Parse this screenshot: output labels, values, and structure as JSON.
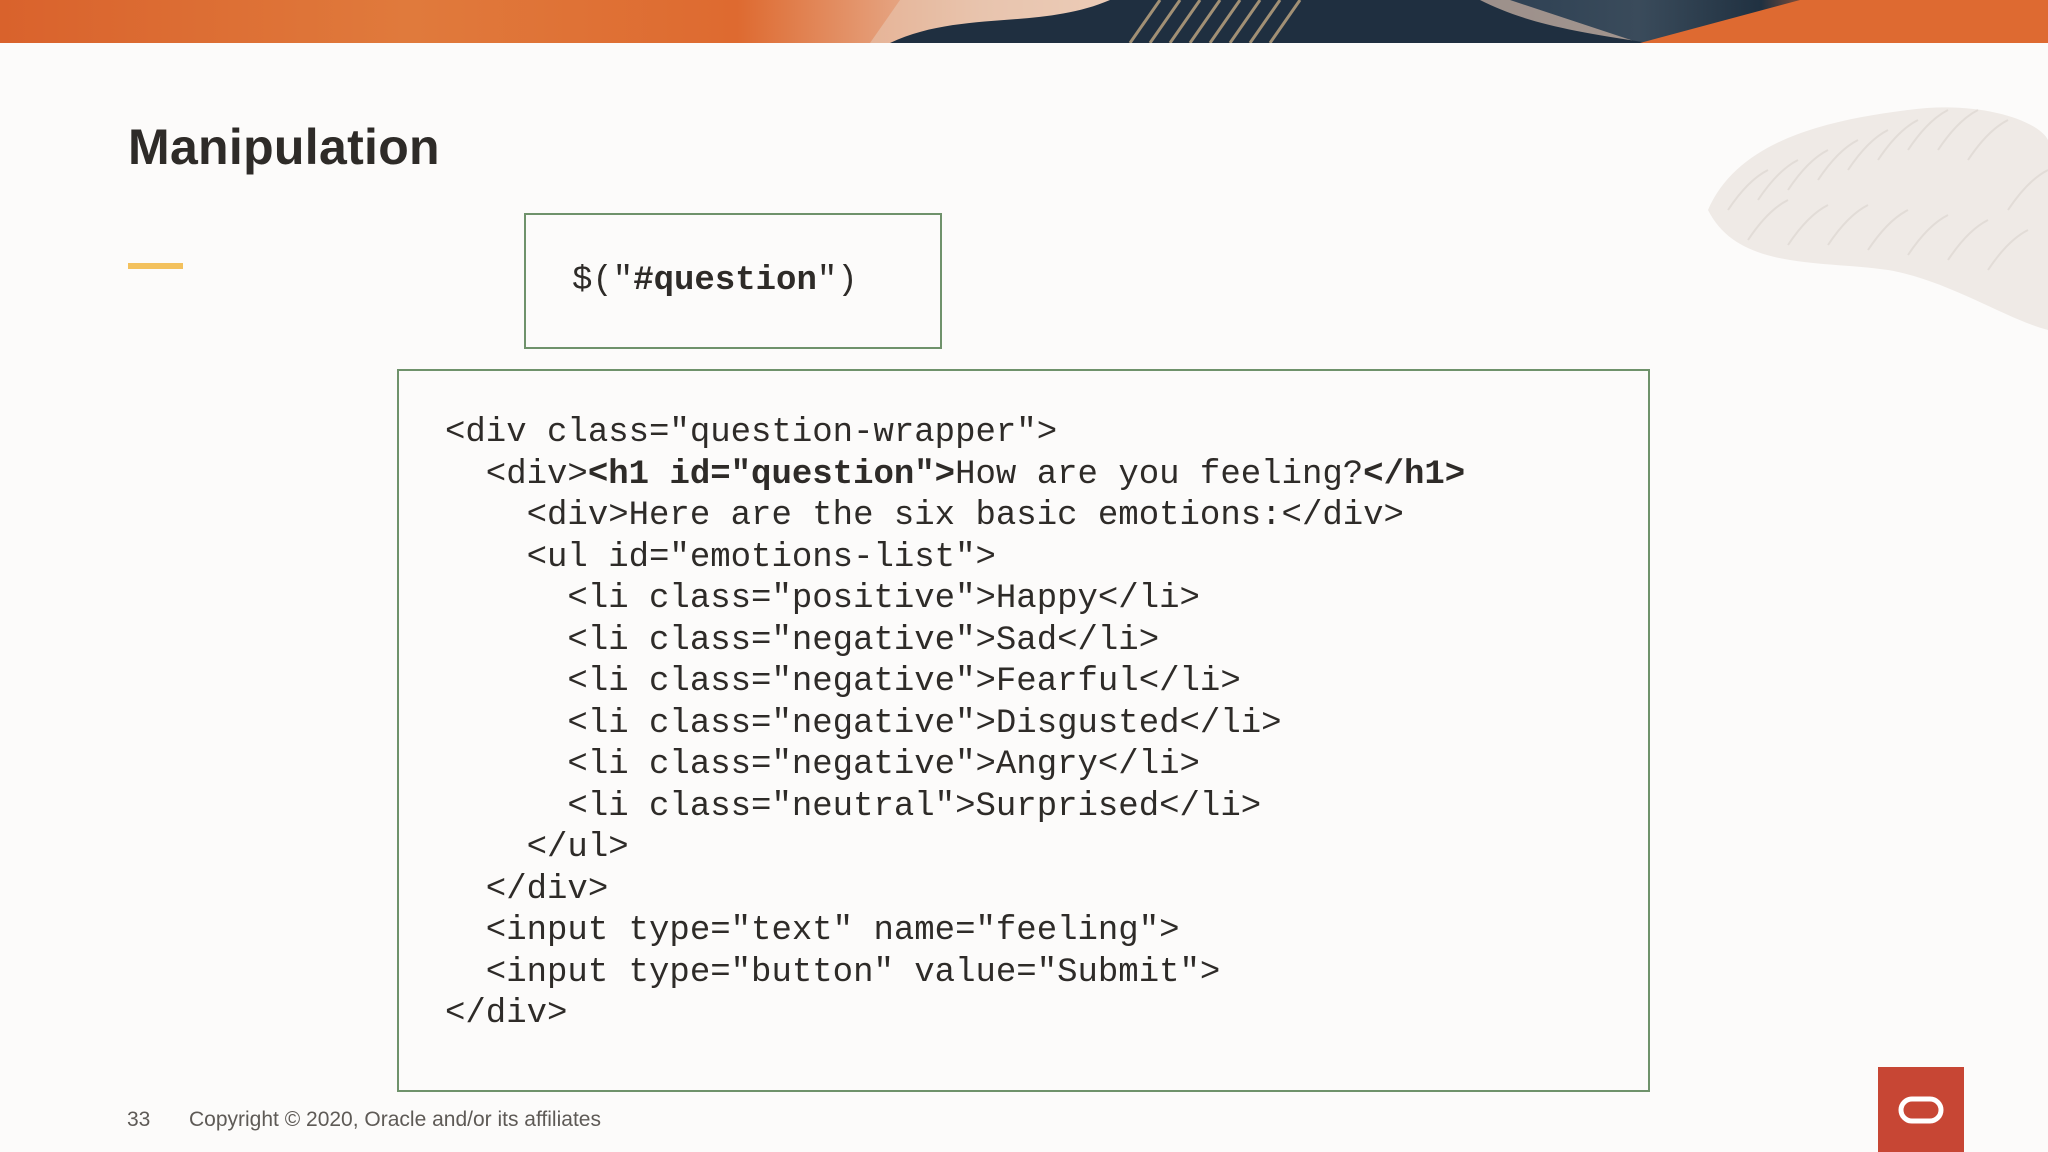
{
  "slide": {
    "title": "Manipulation",
    "page_number": "33",
    "copyright": "Copyright © 2020, Oracle and/or its affiliates"
  },
  "selector": {
    "prefix": "$(\"",
    "id": "#question",
    "suffix": "\")"
  },
  "code_lines": [
    {
      "parts": [
        {
          "t": "<div class=\"question-wrapper\">"
        }
      ]
    },
    {
      "parts": [
        {
          "t": "  <div>"
        },
        {
          "t": "<h1 id=\"question\">",
          "b": true
        },
        {
          "t": "How are you feeling?"
        },
        {
          "t": "</h1>",
          "b": true
        }
      ]
    },
    {
      "parts": [
        {
          "t": "    <div>Here are the six basic emotions:</div>"
        }
      ]
    },
    {
      "parts": [
        {
          "t": "    <ul id=\"emotions-list\">"
        }
      ]
    },
    {
      "parts": [
        {
          "t": "      <li class=\"positive\">Happy</li>"
        }
      ]
    },
    {
      "parts": [
        {
          "t": "      <li class=\"negative\">Sad</li>"
        }
      ]
    },
    {
      "parts": [
        {
          "t": "      <li class=\"negative\">Fearful</li>"
        }
      ]
    },
    {
      "parts": [
        {
          "t": "      <li class=\"negative\">Disgusted</li>"
        }
      ]
    },
    {
      "parts": [
        {
          "t": "      <li class=\"negative\">Angry</li>"
        }
      ]
    },
    {
      "parts": [
        {
          "t": "      <li class=\"neutral\">Surprised</li>"
        }
      ]
    },
    {
      "parts": [
        {
          "t": "    </ul>"
        }
      ]
    },
    {
      "parts": [
        {
          "t": "  </div>"
        }
      ]
    },
    {
      "parts": [
        {
          "t": "  <input type=\"text\" name=\"feeling\">"
        }
      ]
    },
    {
      "parts": [
        {
          "t": "  <input type=\"button\" value=\"Submit\">"
        }
      ]
    },
    {
      "parts": [
        {
          "t": "</div>"
        }
      ]
    }
  ],
  "icons": {
    "logo": "oracle-logo-icon"
  },
  "colors": {
    "logo_red": "#c74634",
    "accent_yellow": "#f3c15d",
    "box_border": "#6f926b",
    "text": "#2e2b28"
  }
}
